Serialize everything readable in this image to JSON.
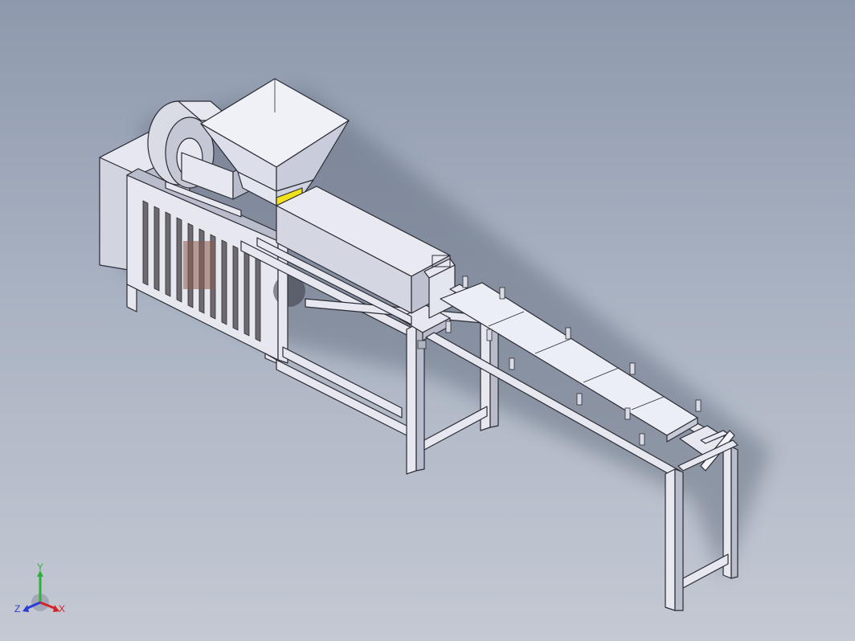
{
  "viewport": {
    "background_top": "#8e99ad",
    "background_bottom": "#c4c9d3"
  },
  "model": {
    "subject": "extruder-machine-with-conveyor",
    "accent_colors": {
      "hopper_band": "#f2e21e",
      "body": "#e6e7ef",
      "shadow": "#6c7688"
    }
  },
  "triad": {
    "x_label": "X",
    "y_label": "Y",
    "z_label": "Z",
    "x_color": "#d3232a",
    "y_color": "#2fae3a",
    "z_color": "#2a3bd6"
  }
}
